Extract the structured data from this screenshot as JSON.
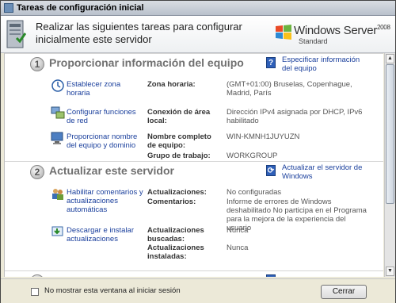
{
  "window": {
    "title": "Tareas de configuración inicial"
  },
  "header": {
    "title": "Realizar las siguientes tareas para configurar inicialmente este servidor",
    "logo_text": "Windows Server",
    "logo_version": "2008",
    "logo_edition": "Standard"
  },
  "sections": [
    {
      "number": "1",
      "title": "Proporcionar información del equipo",
      "link": "Especificar información del equipo",
      "tasks": [
        {
          "link": "Establecer zona horaria",
          "icon": "clock-icon",
          "fields": [
            {
              "label": "Zona horaria:",
              "value": "(GMT+01:00) Bruselas, Copenhague, Madrid, París"
            }
          ]
        },
        {
          "link": "Configurar funciones de red",
          "icon": "network-icon",
          "fields": [
            {
              "label": "Conexión de área local:",
              "value": "Dirección IPv4 asignada por DHCP, IPv6 habilitado"
            }
          ]
        },
        {
          "link": "Proporcionar nombre del equipo y dominio",
          "icon": "computer-icon",
          "fields": [
            {
              "label": "Nombre completo de equipo:",
              "value": "WIN-KMNH1JUYUZN"
            },
            {
              "label": "Grupo de trabajo:",
              "value": "WORKGROUP"
            }
          ]
        }
      ]
    },
    {
      "number": "2",
      "title": "Actualizar este servidor",
      "link": "Actualizar el servidor de Windows",
      "tasks": [
        {
          "link": "Habilitar comentarios y actualizaciones automáticas",
          "icon": "users-icon",
          "fields": [
            {
              "label": "Actualizaciones:",
              "value": "No configuradas"
            },
            {
              "label": "Comentarios:",
              "value": "Informe de errores de Windows deshabilitado No participa en el Programa para la mejora de la experiencia del usuario"
            }
          ]
        },
        {
          "link": "Descargar e instalar actualizaciones",
          "icon": "update-icon",
          "fields": [
            {
              "label": "Actualizaciones buscadas:",
              "value": "Nunca"
            },
            {
              "label": "Actualizaciones instaladas:",
              "value": "Nunca"
            }
          ]
        }
      ]
    }
  ],
  "footer": {
    "checkbox_label": "No mostrar esta ventana al iniciar sesión",
    "close_button": "Cerrar"
  }
}
